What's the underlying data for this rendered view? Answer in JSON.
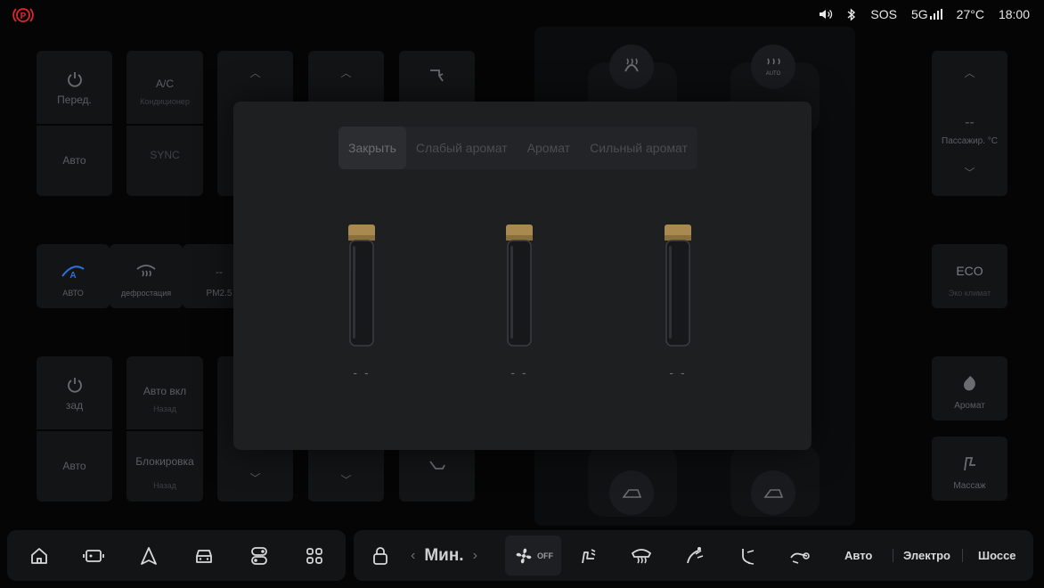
{
  "status_bar": {
    "left_icon": "parking-brake-icon",
    "sos": "SOS",
    "network": "5G",
    "temperature": "27°C",
    "time": "18:00"
  },
  "background": {
    "front_power_label": "Перед.",
    "front_auto_label": "Авто",
    "ac_label": "A/C",
    "ac_sub": "Кондиционер",
    "sync_label": "SYNC",
    "auto_windshield_label": "АВТО",
    "defrost_label": "дефростация",
    "pm25_value": "--",
    "pm25_label": "PM2.5",
    "rear_power_label": "зад",
    "rear_auto_label": "Авто",
    "auto_on_label": "Авто вкл",
    "auto_on_sub": "Назад",
    "lock_label": "Блокировка",
    "lock_sub": "Назад",
    "passenger_temp_value": "--",
    "passenger_temp_label": "Пассажир. °C",
    "eco_label": "ECO",
    "eco_sub": "Эко климат",
    "aroma_label": "Аромат",
    "massage_label": "Массаж",
    "heat_label": "AUTO"
  },
  "fragrance_modal": {
    "tabs": [
      "Закрыть",
      "Слабый аромат",
      "Аромат",
      "Сильный аромат"
    ],
    "active_tab": "Закрыть",
    "vials": [
      {
        "label": "- -"
      },
      {
        "label": "- -"
      },
      {
        "label": "- -"
      }
    ]
  },
  "bottom_bar": {
    "fan_speed_label": "Мин.",
    "fan_off_label": "OFF",
    "modes": [
      "Авто",
      "Электро",
      "Шоссе"
    ]
  },
  "colors": {
    "accent_red": "#e0262c",
    "cap_gold": "#a8894f",
    "accent_blue": "#2f6fd8"
  }
}
